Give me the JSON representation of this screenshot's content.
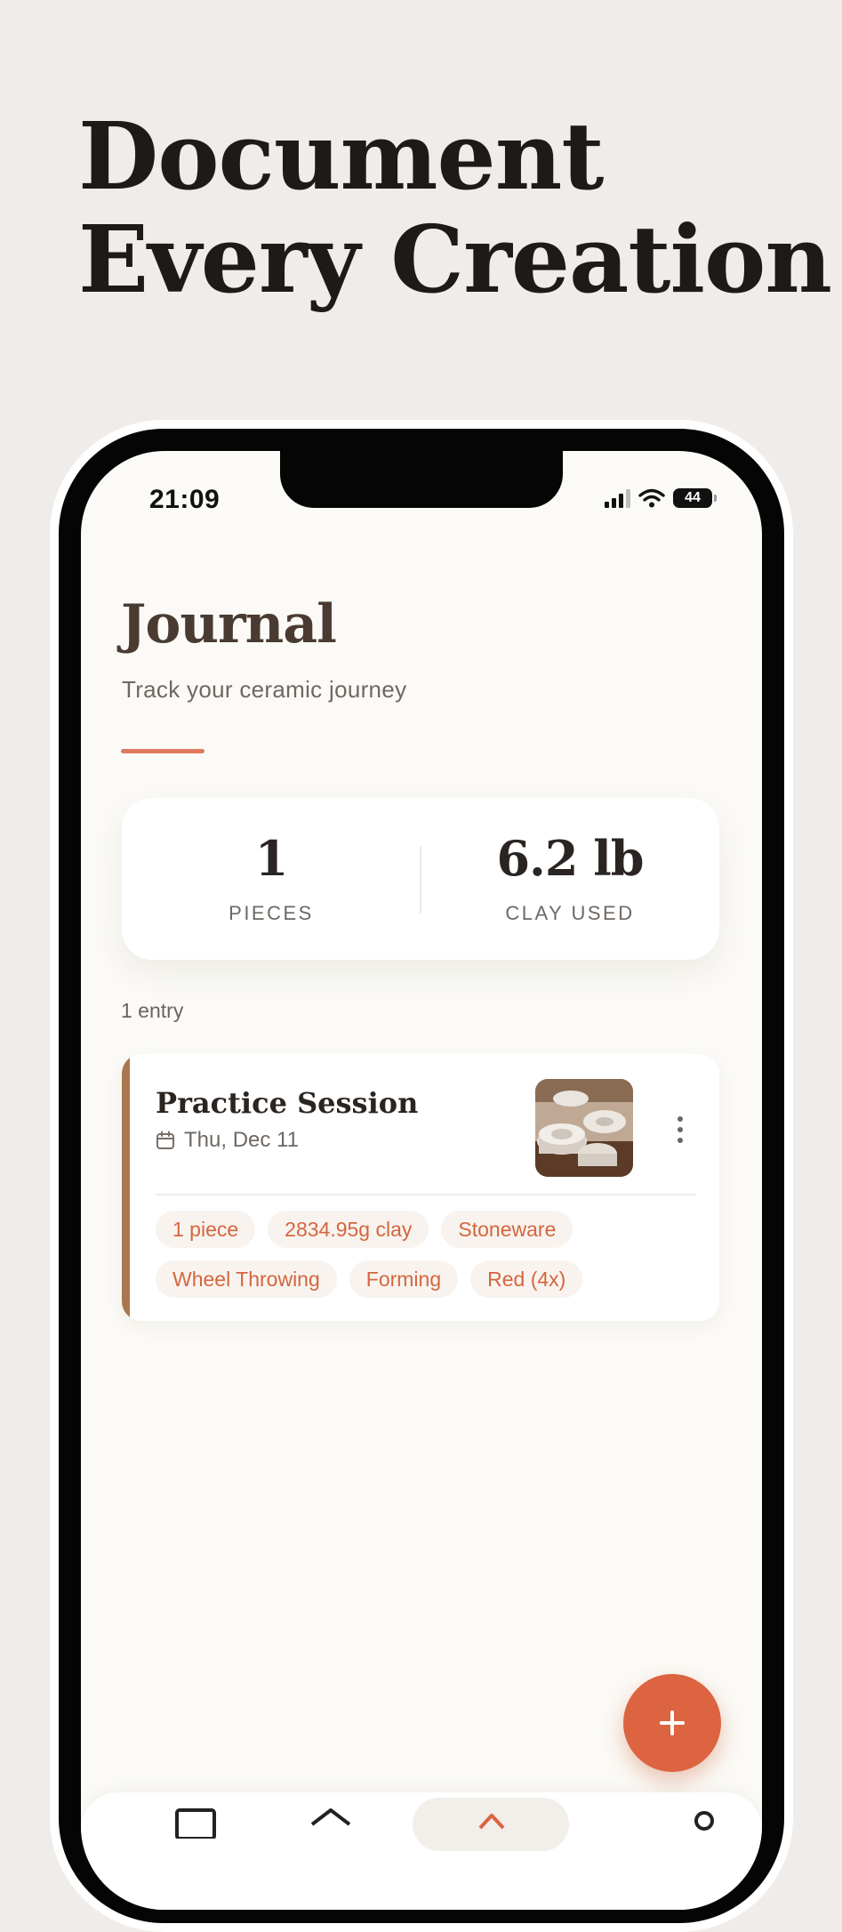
{
  "headline": {
    "line1": "Document",
    "line2": "Every Creation"
  },
  "status_bar": {
    "time": "21:09",
    "battery": "44"
  },
  "journal": {
    "title": "Journal",
    "subtitle": "Track your ceramic journey"
  },
  "stats": {
    "pieces": {
      "value": "1",
      "label": "PIECES"
    },
    "clay": {
      "value": "6.2 lb",
      "label": "CLAY USED"
    }
  },
  "entry_count": "1 entry",
  "entries": [
    {
      "title": "Practice Session",
      "date": "Thu, Dec 11",
      "tags": [
        "1 piece",
        "2834.95g clay",
        "Stoneware",
        "Wheel Throwing",
        "Forming",
        "Red (4x)"
      ]
    }
  ],
  "colors": {
    "accent": "#dc6440",
    "entry_bar": "#a9774f",
    "title_brown": "#4a3b32",
    "tag_text": "#d4663f"
  },
  "icons": {
    "calendar": "calendar-icon",
    "more": "more-vertical-icon",
    "fab": "plus-icon",
    "nav": [
      "journal-icon",
      "home-icon",
      "studio-icon",
      "profile-icon"
    ]
  }
}
